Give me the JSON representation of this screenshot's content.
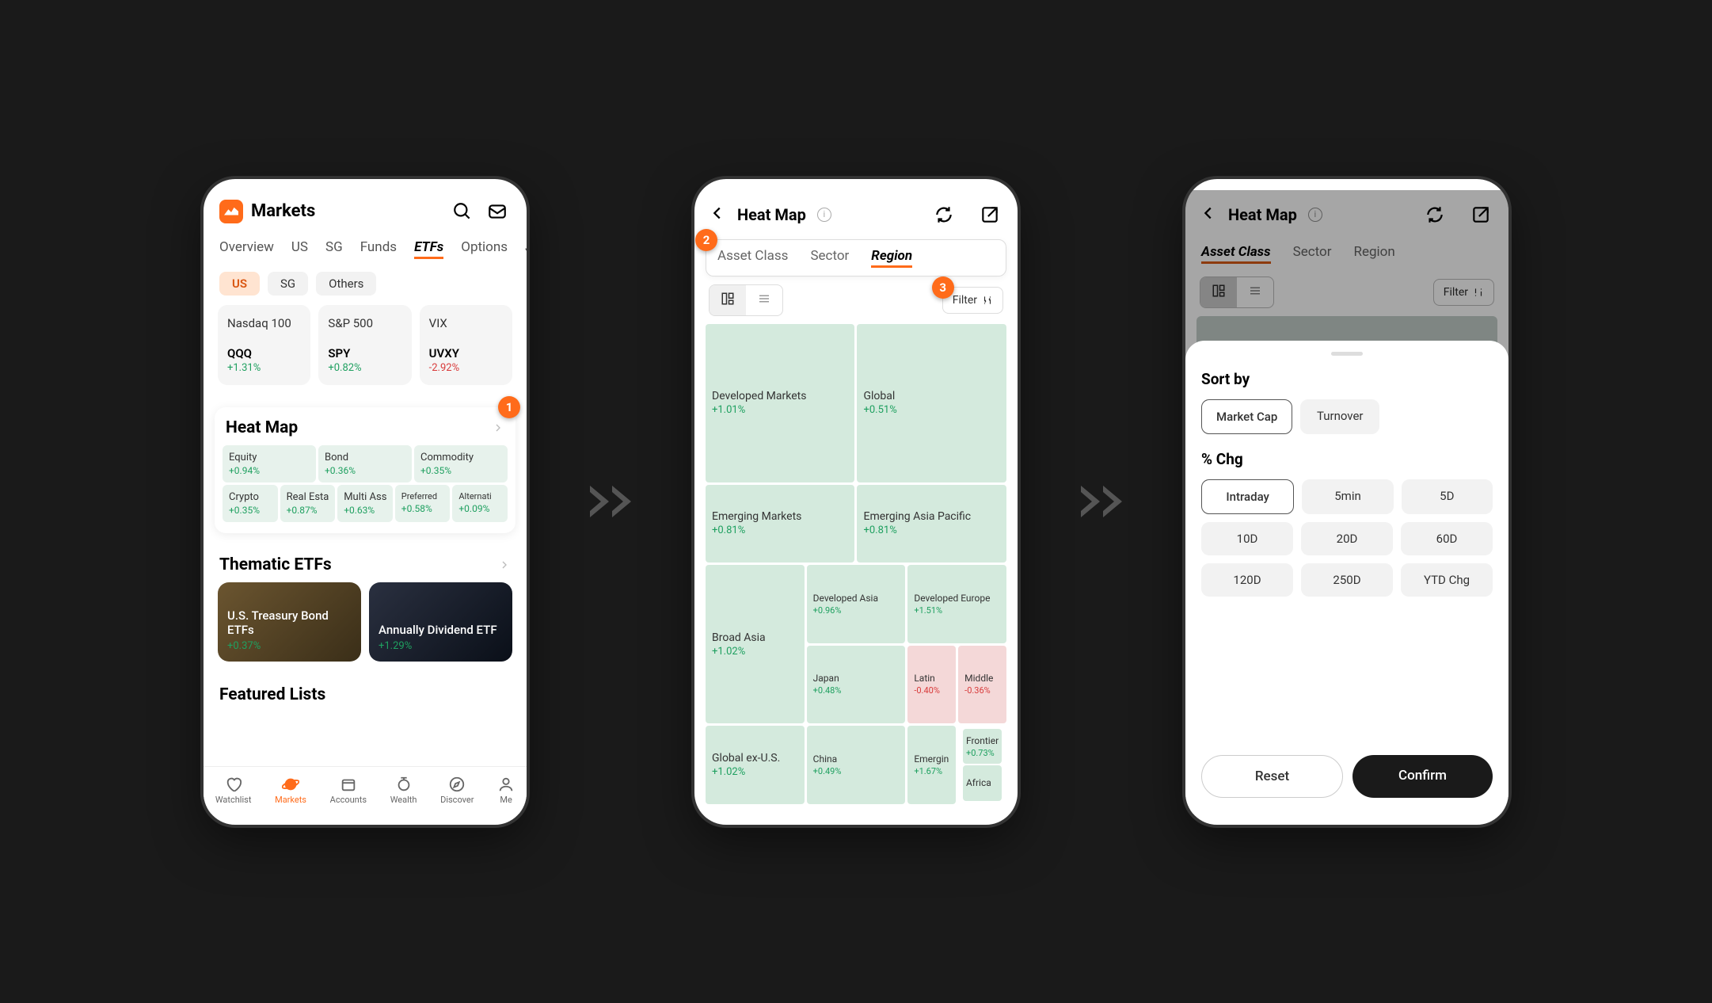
{
  "screen1": {
    "title": "Markets",
    "tabs": [
      "Overview",
      "US",
      "SG",
      "Funds",
      "ETFs",
      "Options",
      "JP"
    ],
    "active_tab": "ETFs",
    "chips": [
      "US",
      "SG",
      "Others"
    ],
    "active_chip": "US",
    "index_cards": [
      {
        "name": "Nasdaq 100",
        "symbol": "QQQ",
        "change": "+1.31%",
        "dir": "pos"
      },
      {
        "name": "S&P 500",
        "symbol": "SPY",
        "change": "+0.82%",
        "dir": "pos"
      },
      {
        "name": "VIX",
        "symbol": "UVXY",
        "change": "-2.92%",
        "dir": "neg"
      }
    ],
    "heatmap_title": "Heat Map",
    "heatmap_tiles": [
      {
        "name": "Equity",
        "change": "+0.94%",
        "dir": "pos"
      },
      {
        "name": "Bond",
        "change": "+0.36%",
        "dir": "pos"
      },
      {
        "name": "Commodity",
        "change": "+0.35%",
        "dir": "pos"
      },
      {
        "name": "Crypto",
        "change": "+0.35%",
        "dir": "pos"
      },
      {
        "name": "Real Estate",
        "change": "+0.87%",
        "dir": "pos"
      },
      {
        "name": "Multi Asset",
        "change": "+0.63%",
        "dir": "pos"
      },
      {
        "name": "Preferred",
        "change": "+0.58%",
        "dir": "pos"
      },
      {
        "name": "Alternati",
        "change": "+0.09%",
        "dir": "pos"
      }
    ],
    "thematic_title": "Thematic ETFs",
    "thematic_cards": [
      {
        "name": "U.S. Treasury Bond ETFs",
        "change": "+0.37%",
        "dir": "pos",
        "theme": "gold"
      },
      {
        "name": "Annually Dividend ETF",
        "change": "+1.29%",
        "dir": "pos",
        "theme": "dark"
      }
    ],
    "featured_title": "Featured Lists",
    "nav": [
      {
        "label": "Watchlist"
      },
      {
        "label": "Markets"
      },
      {
        "label": "Accounts"
      },
      {
        "label": "Wealth"
      },
      {
        "label": "Discover"
      },
      {
        "label": "Me"
      }
    ],
    "active_nav": "Markets"
  },
  "screen2": {
    "title": "Heat Map",
    "tabs": [
      "Asset Class",
      "Sector",
      "Region"
    ],
    "active_tab": "Region",
    "filter_label": "Filter",
    "cells": [
      {
        "name": "Developed Markets",
        "change": "+1.01%",
        "dir": "pos"
      },
      {
        "name": "Global",
        "change": "+0.51%",
        "dir": "pos"
      },
      {
        "name": "Emerging Markets",
        "change": "+0.81%",
        "dir": "pos"
      },
      {
        "name": "Emerging Asia Pacific",
        "change": "+0.81%",
        "dir": "pos"
      },
      {
        "name": "Broad Asia",
        "change": "+1.02%",
        "dir": "pos"
      },
      {
        "name": "Developed Asia",
        "change": "+0.96%",
        "dir": "pos"
      },
      {
        "name": "Developed Europe",
        "change": "+1.51%",
        "dir": "pos"
      },
      {
        "name": "Japan",
        "change": "+0.48%",
        "dir": "pos"
      },
      {
        "name": "Latin",
        "change": "-0.40%",
        "dir": "neg"
      },
      {
        "name": "Middle",
        "change": "-0.36%",
        "dir": "neg"
      },
      {
        "name": "Global ex-U.S.",
        "change": "+1.02%",
        "dir": "pos"
      },
      {
        "name": "China",
        "change": "+0.49%",
        "dir": "pos"
      },
      {
        "name": "Emergin",
        "change": "+1.67%",
        "dir": "pos"
      },
      {
        "name": "Frontier",
        "change": "+0.73%",
        "dir": "pos"
      },
      {
        "name": "Africa",
        "change": "",
        "dir": "pos"
      }
    ]
  },
  "screen3": {
    "title": "Heat Map",
    "tabs": [
      "Asset Class",
      "Sector",
      "Region"
    ],
    "active_tab": "Asset Class",
    "filter_label": "Filter",
    "sort_title": "Sort by",
    "sort_options": [
      "Market Cap",
      "Turnover"
    ],
    "sort_selected": "Market Cap",
    "chg_title": "% Chg",
    "chg_options": [
      "Intraday",
      "5min",
      "5D",
      "10D",
      "20D",
      "60D",
      "120D",
      "250D",
      "YTD Chg"
    ],
    "chg_selected": "Intraday",
    "reset_label": "Reset",
    "confirm_label": "Confirm"
  },
  "badges": {
    "b1": "1",
    "b2": "2",
    "b3": "3"
  }
}
